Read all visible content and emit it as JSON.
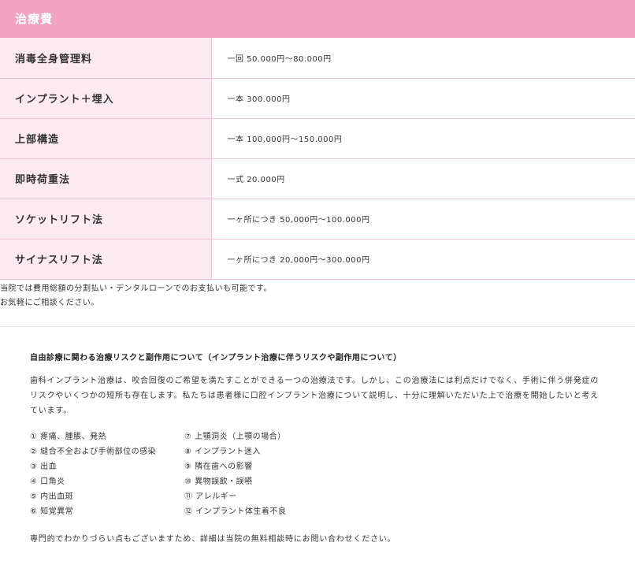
{
  "fees": {
    "title": "治療費",
    "rows": [
      {
        "label": "消毒全身管理料",
        "value": "一回 50.000円～80.000円"
      },
      {
        "label": "インプラント＋埋入",
        "value": "一本 300.000円"
      },
      {
        "label": "上部構造",
        "value": "一本 100,000円～150.000円"
      },
      {
        "label": "即時荷重法",
        "value": "一式 20.000円"
      },
      {
        "label": "ソケットリフト法",
        "value": "一ヶ所につき 50,000円～100.000円"
      },
      {
        "label": "サイナスリフト法",
        "value": "一ヶ所につき 20,000円～300.000円"
      }
    ],
    "payment_note_1": "当院では費用総額の分割払い・デンタルローンでのお支払いも可能です。",
    "payment_note_2": "お気軽にご相談ください。"
  },
  "risks": {
    "title": "自由診療に関わる治療リスクと副作用について（インプラント治療に伴うリスクや副作用について）",
    "body": "歯科インプラント治療は、咬合回復のご希望を満たすことができる一つの治療法です。しかし、この治療法には利点だけでなく、手術に伴う併発症のリスクやいくつかの短所も存在します。私たちは患者様に口腔インプラント治療について説明し、十分に理解いただいた上で治療を開始したいと考えています。",
    "items_left": [
      "① 疼痛、腫脹、発熱",
      "② 縫合不全および手術部位の感染",
      "③ 出血",
      "④ 口角炎",
      "⑤ 内出血斑",
      "⑥ 知覚異常"
    ],
    "items_right": [
      "⑦ 上顎洞炎（上顎の場合）",
      "⑧ インプラント迷入",
      "⑨ 隣在歯への影響",
      "⑩ 異物誤飲・誤嚥",
      "⑪ アレルギー",
      "⑫ インプラント体生着不良"
    ],
    "closing": "専門的でわかりづらい点もございますため、詳細は当院の無料相談時にお問い合わせください。"
  }
}
